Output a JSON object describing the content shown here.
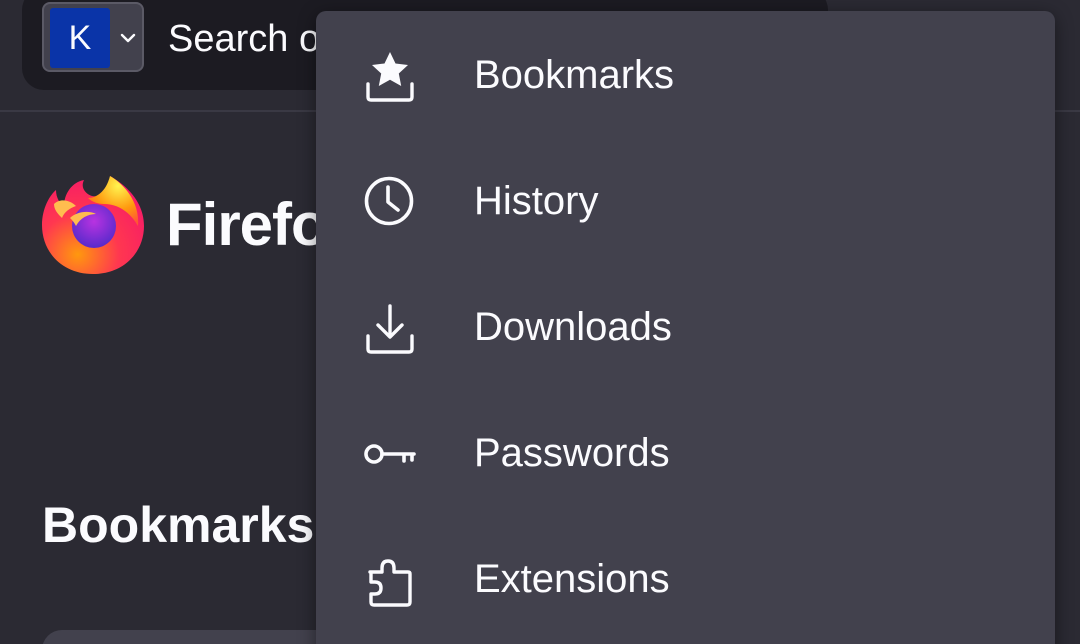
{
  "toolbar": {
    "engine_letter": "K",
    "search_placeholder": "Search o"
  },
  "home": {
    "wordmark": "Firefo",
    "section_title": "Bookmarks"
  },
  "menu": {
    "items": [
      {
        "label": "Bookmarks",
        "icon": "bookmark-tray-icon"
      },
      {
        "label": "History",
        "icon": "clock-icon"
      },
      {
        "label": "Downloads",
        "icon": "download-icon"
      },
      {
        "label": "Passwords",
        "icon": "key-icon"
      },
      {
        "label": "Extensions",
        "icon": "puzzle-icon"
      }
    ]
  },
  "colors": {
    "background": "#2b2a33",
    "menu_background": "#42414d",
    "url_bar": "#1c1b22",
    "engine_blue": "#0a34a8",
    "text": "#fbfbfe"
  }
}
